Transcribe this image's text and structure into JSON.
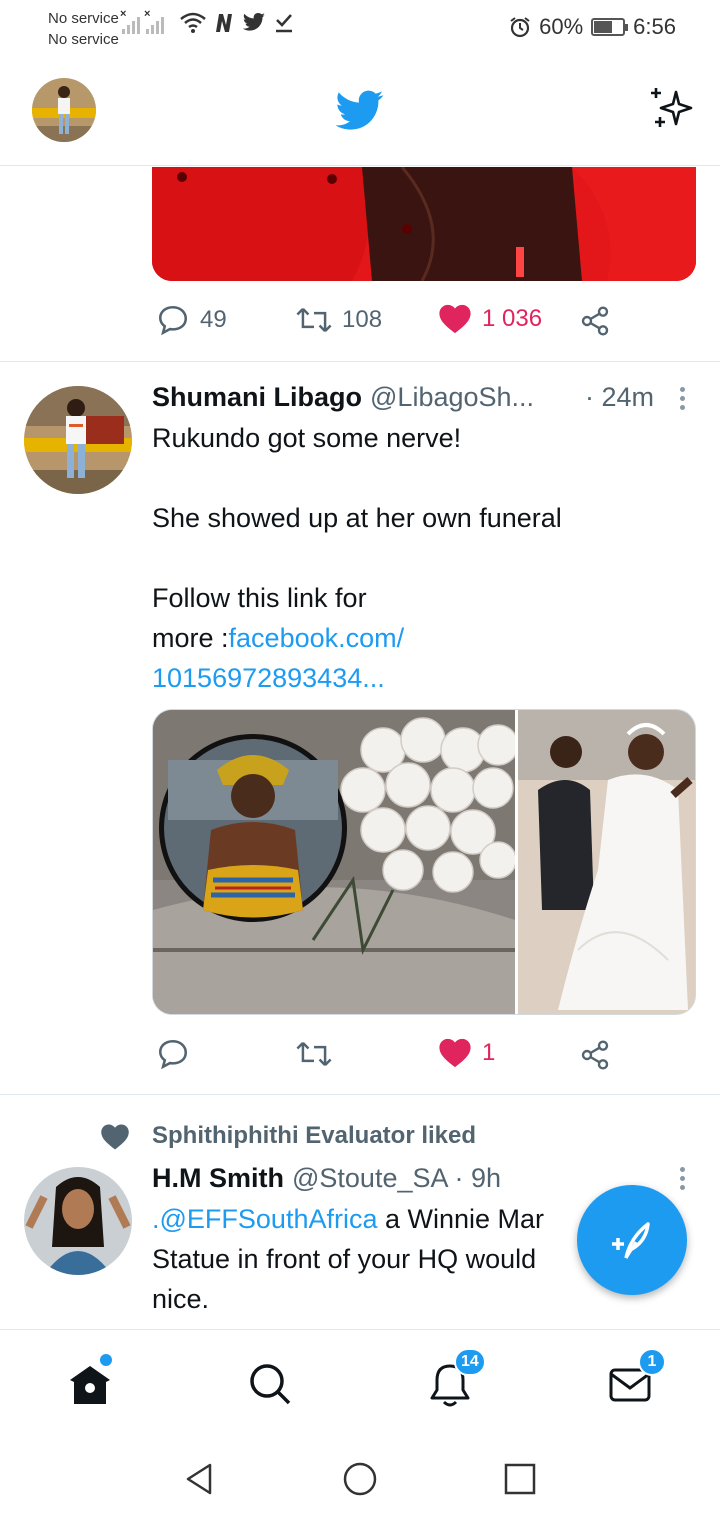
{
  "status_bar": {
    "carrier_line1": "No service",
    "carrier_line2": "No service",
    "battery_percent": "60%",
    "battery_level": 0.6,
    "time": "6:56"
  },
  "header": {
    "logo_icon": "twitter-bird-icon",
    "sparkle_icon": "sparkle-icon"
  },
  "tweet1": {
    "reply_count": "49",
    "retweet_count": "108",
    "like_count": "1 036"
  },
  "tweet2": {
    "name": "Shumani Libago",
    "handle": "@LibagoSh...",
    "time": "· 24m",
    "text_line1": "Rukundo got some nerve!",
    "text_line2": "She showed up at her own funeral",
    "text_line3": "Follow this link for",
    "text_line4_prefix": "more :",
    "link_part1": "facebook.com/",
    "link_part2": "10156972893434...",
    "reply_count": "",
    "retweet_count": "",
    "like_count": "1"
  },
  "tweet3": {
    "liked_by": "Sphithiphithi Evaluator liked",
    "name": "H.M Smith",
    "handle": "@Stoute_SA",
    "time": "· 9h",
    "mention": ".@EFFSouthAfrica",
    "text_line1_rest": " a Winnie Mar",
    "text_line2": "Statue in front of your HQ would",
    "text_line3": "nice."
  },
  "bottom_nav": {
    "notifications_badge": "14",
    "messages_badge": "1"
  },
  "colors": {
    "accent": "#1d9bf0",
    "like": "#e0245e",
    "muted": "#536471"
  }
}
